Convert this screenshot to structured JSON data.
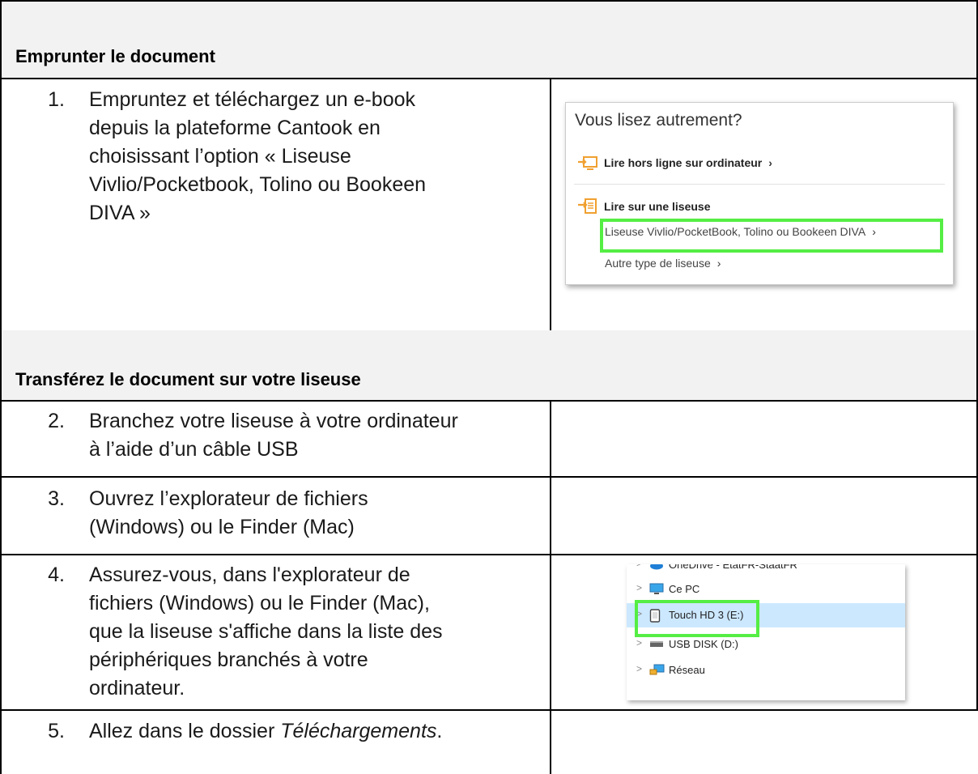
{
  "section1": {
    "title": "Emprunter le document"
  },
  "section2": {
    "title": "Transférez le document sur votre liseuse"
  },
  "steps": [
    {
      "number": "1.",
      "text": "Empruntez et téléchargez un e-book\ndepuis la plateforme Cantook en\nchoisissant l’option « Liseuse\nVivlio/Pocketbook, Tolino ou Bookeen\nDIVA »"
    },
    {
      "number": "2.",
      "text": "Branchez votre liseuse à votre ordinateur\nà l’aide d’un câble USB"
    },
    {
      "number": "3.",
      "text": "Ouvrez l’explorateur de fichiers\n(Windows) ou le Finder (Mac)"
    },
    {
      "number": "4.",
      "text": "Assurez-vous, dans l'explorateur de\nfichiers (Windows) ou le Finder (Mac),\nque la liseuse s'affiche dans la liste des\npériphériques branchés à votre\nordinateur."
    },
    {
      "number": "5.",
      "text_before": "Allez dans le dossier ",
      "text_italic": "Téléchargements",
      "text_after": "."
    }
  ],
  "cantook_panel": {
    "title": "Vous lisez autrement?",
    "offline_label": "Lire hors ligne sur ordinateur",
    "reader_label": "Lire sur une liseuse",
    "option_vivlio": "Liseuse Vivlio/PocketBook, Tolino ou Bookeen DIVA",
    "option_other": "Autre type de liseuse",
    "chevron": "›",
    "highlight_color": "#55ee44"
  },
  "explorer_panel": {
    "items": [
      {
        "label": "OneDrive - EtatFR-StaatFR",
        "icon": "cloud-icon"
      },
      {
        "label": "Ce PC",
        "icon": "computer-icon"
      },
      {
        "label": "Touch HD 3 (E:)",
        "icon": "ereader-icon",
        "selected": true
      },
      {
        "label": "USB DISK (D:)",
        "icon": "drive-icon"
      },
      {
        "label": "Réseau",
        "icon": "network-icon"
      }
    ],
    "caret": ">",
    "highlight_color": "#55ee44",
    "selected_bg": "#cce8ff"
  }
}
